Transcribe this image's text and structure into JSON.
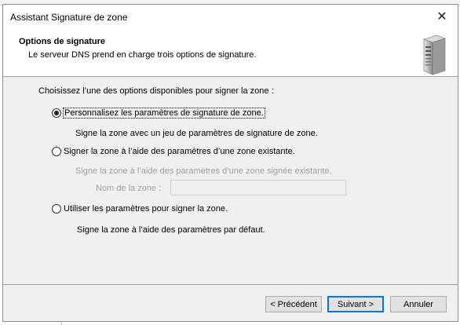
{
  "window": {
    "title": "Assistant Signature de zone"
  },
  "header": {
    "title": "Options de signature",
    "subtitle": "Le serveur DNS prend en charge trois options de signature."
  },
  "body": {
    "intro": "Choisissez l’une des options disponibles pour signer la zone :",
    "options": [
      {
        "label": "Personnalisez les paramètres de signature de zone.",
        "description": "Signe la zone avec un jeu de paramètres de signature de zone.",
        "checked": true
      },
      {
        "label": "Signer la zone à l’aide des paramètres d’une zone existante.",
        "description": "Signe la zone à l’aide des paramètres d’une zone signée existante.",
        "checked": false
      },
      {
        "label": "Utiliser les paramètres pour signer la zone.",
        "description": "Signe la zone à l’aide des paramètres par défaut.",
        "checked": false
      }
    ],
    "zone_name_label": "Nom de la zone :",
    "zone_name_value": ""
  },
  "buttons": {
    "back": "< Précédent",
    "next": "Suivant >",
    "cancel": "Annuler"
  },
  "icons": {
    "header": "server-icon",
    "close": "close-icon"
  }
}
